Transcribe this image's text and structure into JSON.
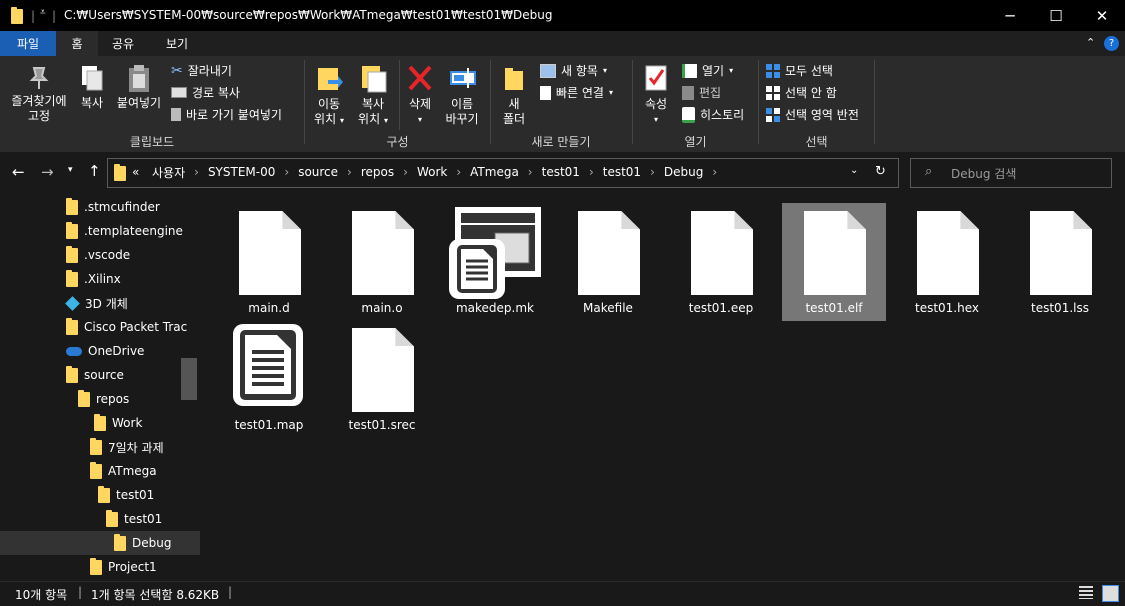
{
  "window": {
    "title_path": "C:₩Users₩SYSTEM-00₩source₩repos₩Work₩ATmega₩test01₩test01₩Debug",
    "minimize_icon": "minimize-icon",
    "maximize_icon": "maximize-icon",
    "close_icon": "close-icon"
  },
  "ribbon_tabs": [
    "파일",
    "홈",
    "공유",
    "보기"
  ],
  "ribbon": {
    "pin_label_1": "즐겨찾기에",
    "pin_label_2": "고정",
    "copy": "복사",
    "paste": "붙여넣기",
    "cut": "잘라내기",
    "copy_path": "경로 복사",
    "paste_shortcut": "바로 가기 붙여넣기",
    "clipboard_group": "클립보드",
    "move_1": "이동",
    "move_2": "위치",
    "copyto_1": "복사",
    "copyto_2": "위치",
    "delete": "삭제",
    "rename_1": "이름",
    "rename_2": "바꾸기",
    "organize_group": "구성",
    "newfolder_1": "새",
    "newfolder_2": "폴더",
    "new_item": "새 항목",
    "easy_access": "빠른 연결",
    "new_group": "새로 만들기",
    "properties": "속성",
    "open": "열기",
    "edit": "편집",
    "history": "히스토리",
    "open_group": "열기",
    "select_all": "모두 선택",
    "select_none": "선택 안 함",
    "invert_select": "선택 영역 반전",
    "select_group": "선택"
  },
  "breadcrumb": [
    "사용자",
    "SYSTEM-00",
    "source",
    "repos",
    "Work",
    "ATmega",
    "test01",
    "test01",
    "Debug"
  ],
  "breadcrumb_prefix": "«",
  "search": {
    "placeholder": "Debug 검색"
  },
  "nav_items": [
    {
      "label": ".stmcufinder"
    },
    {
      "label": ".templateengine"
    },
    {
      "label": ".vscode"
    },
    {
      "label": ".Xilinx"
    },
    {
      "label": "3D 개체"
    },
    {
      "label": "Cisco Packet Trac"
    },
    {
      "label": "OneDrive"
    },
    {
      "label": "source"
    },
    {
      "label": "repos"
    },
    {
      "label": "Work"
    },
    {
      "label": "7일차 과제"
    },
    {
      "label": "ATmega"
    },
    {
      "label": "test01"
    },
    {
      "label": "test01"
    },
    {
      "label": "Debug"
    },
    {
      "label": "Project1"
    }
  ],
  "files": [
    {
      "name": "main.d",
      "icon": "blank-file-icon"
    },
    {
      "name": "main.o",
      "icon": "blank-file-icon"
    },
    {
      "name": "makedep.mk",
      "icon": "makefile-icon"
    },
    {
      "name": "Makefile",
      "icon": "blank-file-icon"
    },
    {
      "name": "test01.eep",
      "icon": "blank-file-icon"
    },
    {
      "name": "test01.elf",
      "icon": "blank-file-icon",
      "selected": true
    },
    {
      "name": "test01.hex",
      "icon": "blank-file-icon"
    },
    {
      "name": "test01.lss",
      "icon": "blank-file-icon"
    },
    {
      "name": "test01.map",
      "icon": "text-document-icon"
    },
    {
      "name": "test01.srec",
      "icon": "blank-file-icon"
    }
  ],
  "status": {
    "count": "10개 항목",
    "selection": "1개 항목 선택함 8.62KB"
  },
  "colors": {
    "accent": "#1a5fb4",
    "folder": "#ffd760",
    "selected_item": "#777777"
  }
}
